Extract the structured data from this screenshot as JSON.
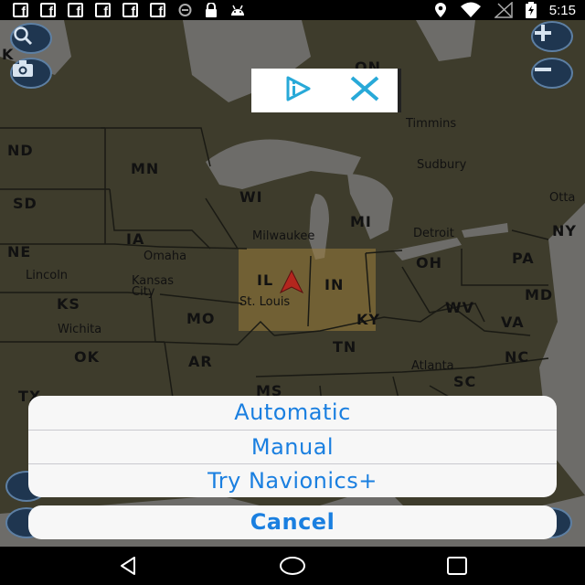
{
  "status_bar": {
    "time": "5:15",
    "notification_icons": [
      "facebook-icon",
      "facebook-icon",
      "facebook-icon",
      "facebook-icon",
      "facebook-icon",
      "facebook-icon",
      "sync-icon",
      "lock-icon",
      "android-icon"
    ],
    "system_icons": [
      "location-icon",
      "wifi-icon",
      "no-signal-icon",
      "battery-charging-icon"
    ],
    "fb_letter": "f"
  },
  "map": {
    "state_labels": [
      "ND",
      "MN",
      "WI",
      "MI",
      "SD",
      "IA",
      "NE",
      "IL",
      "IN",
      "OH",
      "PA",
      "NY",
      "KS",
      "MO",
      "KY",
      "WV",
      "VA",
      "MD",
      "OK",
      "AR",
      "TN",
      "NC",
      "SC",
      "MS",
      "TX",
      "ON",
      "K"
    ],
    "city_labels": [
      "Timmins",
      "Sudbury",
      "Otta",
      "Milwaukee",
      "Detroit",
      "Omaha",
      "Lincoln",
      "Kansas City",
      "St. Louis",
      "Wichita",
      "Atlanta"
    ],
    "colors": {
      "land": "#3e3c2c",
      "water": "#6d6c69",
      "border": "#1a1a14",
      "highlight": "#9a7d3d"
    }
  },
  "map_controls": {
    "search": "search-icon",
    "camera": "camera-icon",
    "zoom_in": "plus-icon",
    "zoom_out": "minus-icon"
  },
  "ad": {
    "play_icon": "ad-choices-icon",
    "close_icon": "close-icon"
  },
  "action_sheet": {
    "options": [
      "Automatic",
      "Manual",
      "Try Navionics+"
    ],
    "cancel_label": "Cancel",
    "accent_color": "#1a7fe0"
  },
  "nav_bar": [
    "back-icon",
    "home-icon",
    "recents-icon"
  ]
}
